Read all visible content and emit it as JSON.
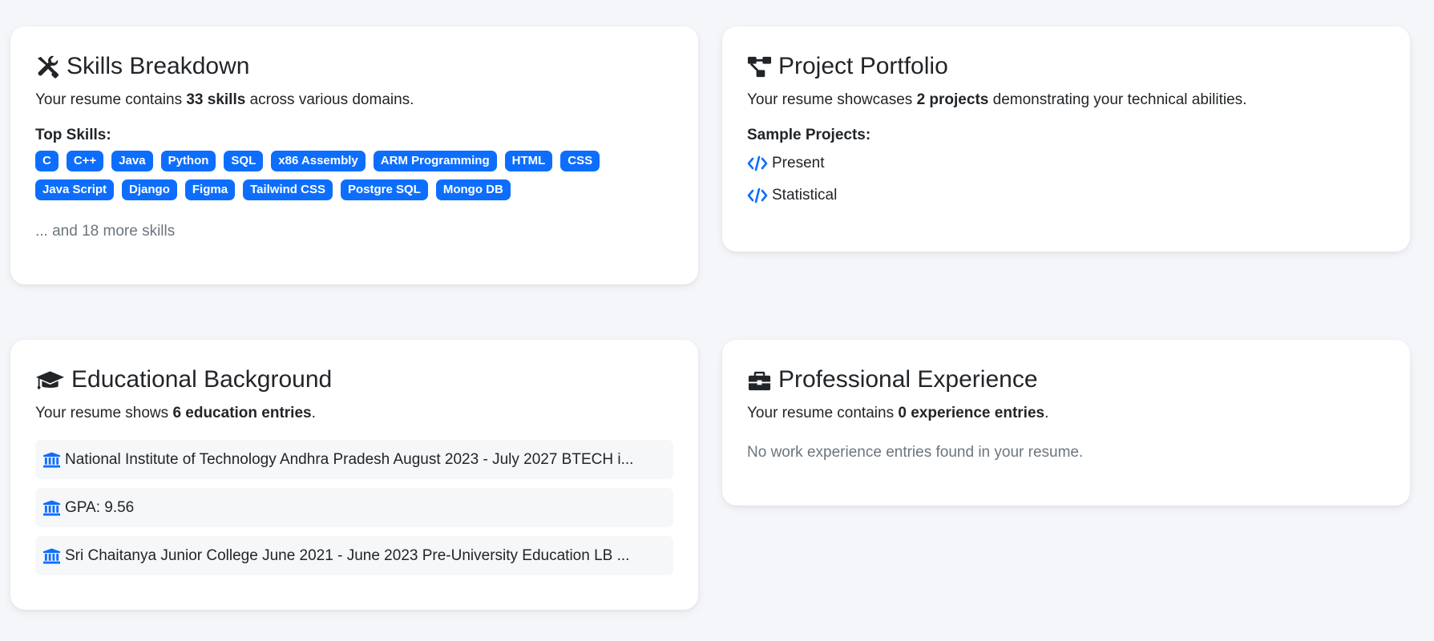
{
  "skills": {
    "title": "Skills Breakdown",
    "summary_prefix": "Your resume contains ",
    "summary_count": "33 skills",
    "summary_suffix": " across various domains.",
    "top_label": "Top Skills:",
    "items": [
      "C",
      "C++",
      "Java",
      "Python",
      "SQL",
      "x86 Assembly",
      "ARM Programming",
      "HTML",
      "CSS",
      "Java Script",
      "Django",
      "Figma",
      "Tailwind CSS",
      "Postgre SQL",
      "Mongo DB"
    ],
    "more_text": "... and 18 more skills"
  },
  "projects": {
    "title": "Project Portfolio",
    "summary_prefix": "Your resume showcases ",
    "summary_count": "2 projects",
    "summary_suffix": " demonstrating your technical abilities.",
    "sample_label": "Sample Projects:",
    "items": [
      "Present",
      "Statistical"
    ]
  },
  "education": {
    "title": "Educational Background",
    "summary_prefix": "Your resume shows ",
    "summary_count": "6 education entries",
    "summary_suffix": ".",
    "items": [
      "National Institute of Technology Andhra Pradesh August 2023 - July 2027 BTECH i...",
      "GPA: 9.56",
      "Sri Chaitanya Junior College June 2021 - June 2023 Pre-University Education LB ..."
    ]
  },
  "experience": {
    "title": "Professional Experience",
    "summary_prefix": "Your resume contains ",
    "summary_count": "0 experience entries",
    "summary_suffix": ".",
    "empty_text": "No work experience entries found in your resume."
  },
  "colors": {
    "accent": "#0d6efd",
    "background": "#f5f6fa",
    "card": "#ffffff",
    "muted_text": "#6c757d"
  },
  "icons": {
    "skills": "tools-icon",
    "projects": "project-diagram-icon",
    "education": "graduation-cap-icon",
    "experience": "briefcase-icon",
    "project_item": "code-icon",
    "education_item": "university-icon"
  }
}
